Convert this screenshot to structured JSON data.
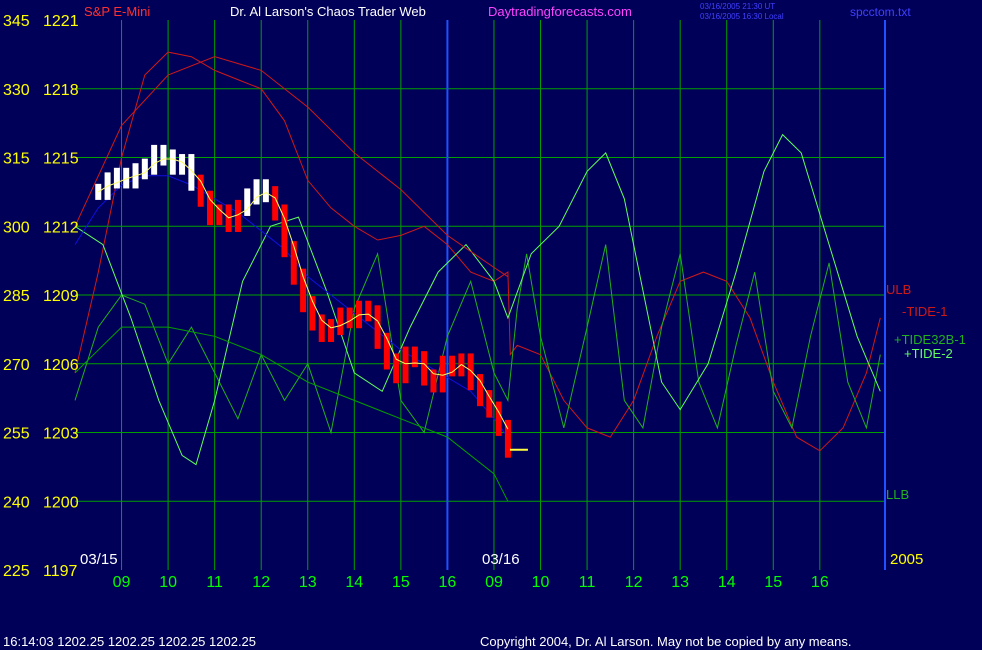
{
  "header": {
    "title_left": "S&P E-Mini",
    "title_main": "Dr. Al Larson's Chaos Trader Web",
    "title_site": "Daytradingforecasts.com",
    "time_ut": "03/16/2005 21:30 UT",
    "time_local": "03/16/2005 16:30 Local",
    "file": "spcctom.txt"
  },
  "footer": {
    "quote": "16:14:03  1202.25  1202.25  1202.25  1202.25",
    "copyright": "Copyright 2004, Dr. Al Larson. May not be copied by any means."
  },
  "colors": {
    "background": "#000058",
    "grid": "#00a000",
    "axis_text": "#ffff00",
    "hour_text": "#00ff00",
    "price_bars": "#ff0000",
    "price_bars_early": "#ffffff",
    "ma": "#ffff60",
    "blue_line": "#1010e0",
    "tide1": "#d01818",
    "tide32b": "#20b020",
    "tide2": "#60ff60",
    "envelope": "#00a000",
    "title_main": "#ffffff",
    "title_site": "#ff44ff",
    "file": "#4040ff"
  },
  "chart_data": {
    "type": "line",
    "y_left_ticks": [
      "345",
      "330",
      "315",
      "300",
      "285",
      "270",
      "255",
      "240",
      "225"
    ],
    "y_right_ticks": [
      "1221",
      "1218",
      "1215",
      "1212",
      "1209",
      "1206",
      "1203",
      "1200",
      "1197"
    ],
    "ylim_price": [
      1197,
      1221
    ],
    "ylim_tide": [
      225,
      345
    ],
    "x_hours": [
      "09",
      "10",
      "11",
      "12",
      "13",
      "14",
      "15",
      "16",
      "09",
      "10",
      "11",
      "12",
      "13",
      "14",
      "15",
      "16"
    ],
    "date_labels": [
      "03/15",
      "03/16"
    ],
    "year_label": "2005",
    "grid": true,
    "labels_right": [
      "ULB",
      "-TIDE-1",
      "+TIDE32B-1",
      "+TIDE-2",
      "LLB"
    ],
    "last_price": 1202.25,
    "price_series": [
      {
        "t": 0.5,
        "v": 1213.5
      },
      {
        "t": 0.7,
        "v": 1214.0
      },
      {
        "t": 0.9,
        "v": 1214.2
      },
      {
        "t": 1.1,
        "v": 1214.0
      },
      {
        "t": 1.3,
        "v": 1214.4
      },
      {
        "t": 1.5,
        "v": 1214.6
      },
      {
        "t": 1.7,
        "v": 1215.2
      },
      {
        "t": 1.9,
        "v": 1215.0
      },
      {
        "t": 2.1,
        "v": 1214.6
      },
      {
        "t": 2.3,
        "v": 1214.8
      },
      {
        "t": 2.5,
        "v": 1213.9
      },
      {
        "t": 2.7,
        "v": 1213.2
      },
      {
        "t": 2.9,
        "v": 1212.4
      },
      {
        "t": 3.1,
        "v": 1212.6
      },
      {
        "t": 3.3,
        "v": 1212.1
      },
      {
        "t": 3.5,
        "v": 1212.8
      },
      {
        "t": 3.7,
        "v": 1213.3
      },
      {
        "t": 3.9,
        "v": 1213.7
      },
      {
        "t": 4.1,
        "v": 1213.4
      },
      {
        "t": 4.3,
        "v": 1212.6
      },
      {
        "t": 4.5,
        "v": 1211.0
      },
      {
        "t": 4.7,
        "v": 1209.8
      },
      {
        "t": 4.9,
        "v": 1208.6
      },
      {
        "t": 5.1,
        "v": 1207.8
      },
      {
        "t": 5.3,
        "v": 1207.3
      },
      {
        "t": 5.5,
        "v": 1207.6
      },
      {
        "t": 5.7,
        "v": 1208.1
      },
      {
        "t": 5.9,
        "v": 1207.9
      },
      {
        "t": 6.1,
        "v": 1208.4
      },
      {
        "t": 6.3,
        "v": 1208.2
      },
      {
        "t": 6.5,
        "v": 1207.0
      },
      {
        "t": 6.7,
        "v": 1206.1
      },
      {
        "t": 6.9,
        "v": 1205.5
      },
      {
        "t": 7.1,
        "v": 1206.4
      },
      {
        "t": 7.3,
        "v": 1206.2
      },
      {
        "t": 7.5,
        "v": 1205.4
      },
      {
        "t": 7.7,
        "v": 1205.1
      },
      {
        "t": 7.9,
        "v": 1206.0
      },
      {
        "t": 8.1,
        "v": 1205.8
      },
      {
        "t": 8.3,
        "v": 1206.1
      },
      {
        "t": 8.5,
        "v": 1205.2
      },
      {
        "t": 8.7,
        "v": 1204.5
      },
      {
        "t": 8.9,
        "v": 1204.0
      },
      {
        "t": 9.1,
        "v": 1203.2
      },
      {
        "t": 9.3,
        "v": 1202.25
      }
    ],
    "series": [
      {
        "name": "-TIDE-1",
        "values": [
          {
            "t": 0,
            "v": 268
          },
          {
            "t": 0.5,
            "v": 290
          },
          {
            "t": 1.0,
            "v": 315
          },
          {
            "t": 1.5,
            "v": 333
          },
          {
            "t": 2.0,
            "v": 338
          },
          {
            "t": 2.5,
            "v": 337
          },
          {
            "t": 3.0,
            "v": 334
          },
          {
            "t": 3.5,
            "v": 332
          },
          {
            "t": 4.0,
            "v": 330
          },
          {
            "t": 4.5,
            "v": 323
          },
          {
            "t": 5.0,
            "v": 310
          },
          {
            "t": 5.5,
            "v": 304
          },
          {
            "t": 6.0,
            "v": 300
          },
          {
            "t": 6.5,
            "v": 297
          },
          {
            "t": 7.0,
            "v": 298
          },
          {
            "t": 7.5,
            "v": 300
          },
          {
            "t": 8.0,
            "v": 296
          },
          {
            "t": 8.5,
            "v": 290
          },
          {
            "t": 9.0,
            "v": 288
          },
          {
            "t": 9.3,
            "v": 290
          },
          {
            "t": 9.35,
            "v": 272
          },
          {
            "t": 9.5,
            "v": 274
          },
          {
            "t": 10.0,
            "v": 272
          },
          {
            "t": 10.5,
            "v": 262
          },
          {
            "t": 11.0,
            "v": 256
          },
          {
            "t": 11.5,
            "v": 254
          },
          {
            "t": 12.0,
            "v": 262
          },
          {
            "t": 12.5,
            "v": 276
          },
          {
            "t": 13.0,
            "v": 288
          },
          {
            "t": 13.5,
            "v": 290
          },
          {
            "t": 14.0,
            "v": 288
          },
          {
            "t": 14.5,
            "v": 280
          },
          {
            "t": 15.0,
            "v": 266
          },
          {
            "t": 15.5,
            "v": 254
          },
          {
            "t": 16.0,
            "v": 251
          },
          {
            "t": 16.5,
            "v": 256
          },
          {
            "t": 17.0,
            "v": 268
          },
          {
            "t": 17.3,
            "v": 280
          }
        ]
      },
      {
        "name": "+TIDE32B-1",
        "values": [
          {
            "t": 0,
            "v": 262
          },
          {
            "t": 0.5,
            "v": 278
          },
          {
            "t": 1.0,
            "v": 285
          },
          {
            "t": 1.5,
            "v": 283
          },
          {
            "t": 2.0,
            "v": 270
          },
          {
            "t": 2.5,
            "v": 278
          },
          {
            "t": 3.0,
            "v": 268
          },
          {
            "t": 3.5,
            "v": 258
          },
          {
            "t": 4.0,
            "v": 272
          },
          {
            "t": 4.5,
            "v": 262
          },
          {
            "t": 5.0,
            "v": 270
          },
          {
            "t": 5.5,
            "v": 255
          },
          {
            "t": 6.0,
            "v": 282
          },
          {
            "t": 6.5,
            "v": 294
          },
          {
            "t": 7.0,
            "v": 262
          },
          {
            "t": 7.5,
            "v": 255
          },
          {
            "t": 8.0,
            "v": 276
          },
          {
            "t": 8.5,
            "v": 288
          },
          {
            "t": 9.0,
            "v": 268
          },
          {
            "t": 9.3,
            "v": 262
          },
          {
            "t": 9.5,
            "v": 282
          },
          {
            "t": 9.7,
            "v": 294
          },
          {
            "t": 10.0,
            "v": 276
          },
          {
            "t": 10.5,
            "v": 256
          },
          {
            "t": 11.0,
            "v": 278
          },
          {
            "t": 11.4,
            "v": 296
          },
          {
            "t": 11.8,
            "v": 262
          },
          {
            "t": 12.2,
            "v": 256
          },
          {
            "t": 12.6,
            "v": 278
          },
          {
            "t": 13.0,
            "v": 294
          },
          {
            "t": 13.4,
            "v": 266
          },
          {
            "t": 13.8,
            "v": 256
          },
          {
            "t": 14.2,
            "v": 274
          },
          {
            "t": 14.6,
            "v": 290
          },
          {
            "t": 15.0,
            "v": 264
          },
          {
            "t": 15.4,
            "v": 256
          },
          {
            "t": 15.8,
            "v": 276
          },
          {
            "t": 16.2,
            "v": 292
          },
          {
            "t": 16.6,
            "v": 266
          },
          {
            "t": 17.0,
            "v": 256
          },
          {
            "t": 17.3,
            "v": 272
          }
        ]
      },
      {
        "name": "+TIDE-2",
        "values": [
          {
            "t": 0,
            "v": 300
          },
          {
            "t": 0.6,
            "v": 296
          },
          {
            "t": 1.2,
            "v": 280
          },
          {
            "t": 1.8,
            "v": 262
          },
          {
            "t": 2.3,
            "v": 250
          },
          {
            "t": 2.6,
            "v": 248
          },
          {
            "t": 3.0,
            "v": 262
          },
          {
            "t": 3.6,
            "v": 288
          },
          {
            "t": 4.2,
            "v": 300
          },
          {
            "t": 4.8,
            "v": 302
          },
          {
            "t": 5.4,
            "v": 286
          },
          {
            "t": 6.0,
            "v": 268
          },
          {
            "t": 6.6,
            "v": 264
          },
          {
            "t": 7.2,
            "v": 278
          },
          {
            "t": 7.8,
            "v": 290
          },
          {
            "t": 8.4,
            "v": 296
          },
          {
            "t": 9.0,
            "v": 288
          },
          {
            "t": 9.3,
            "v": 280
          },
          {
            "t": 9.8,
            "v": 294
          },
          {
            "t": 10.4,
            "v": 300
          },
          {
            "t": 11.0,
            "v": 312
          },
          {
            "t": 11.4,
            "v": 316
          },
          {
            "t": 11.8,
            "v": 306
          },
          {
            "t": 12.2,
            "v": 286
          },
          {
            "t": 12.6,
            "v": 266
          },
          {
            "t": 13.0,
            "v": 260
          },
          {
            "t": 13.6,
            "v": 270
          },
          {
            "t": 14.2,
            "v": 290
          },
          {
            "t": 14.8,
            "v": 312
          },
          {
            "t": 15.2,
            "v": 320
          },
          {
            "t": 15.6,
            "v": 316
          },
          {
            "t": 16.2,
            "v": 296
          },
          {
            "t": 16.8,
            "v": 276
          },
          {
            "t": 17.3,
            "v": 264
          }
        ]
      },
      {
        "name": "ULB",
        "values": [
          {
            "t": 0,
            "v": 300
          },
          {
            "t": 1.0,
            "v": 322
          },
          {
            "t": 2.0,
            "v": 333
          },
          {
            "t": 3.0,
            "v": 337
          },
          {
            "t": 4.0,
            "v": 334
          },
          {
            "t": 5.0,
            "v": 326
          },
          {
            "t": 6.0,
            "v": 316
          },
          {
            "t": 7.0,
            "v": 308
          },
          {
            "t": 8.0,
            "v": 298
          },
          {
            "t": 9.0,
            "v": 291
          },
          {
            "t": 9.3,
            "v": 289
          }
        ]
      },
      {
        "name": "LLB",
        "values": [
          {
            "t": 0,
            "v": 268
          },
          {
            "t": 1.0,
            "v": 278
          },
          {
            "t": 2.0,
            "v": 278
          },
          {
            "t": 3.0,
            "v": 276
          },
          {
            "t": 4.0,
            "v": 272
          },
          {
            "t": 5.0,
            "v": 266
          },
          {
            "t": 6.0,
            "v": 262
          },
          {
            "t": 7.0,
            "v": 258
          },
          {
            "t": 8.0,
            "v": 254
          },
          {
            "t": 9.0,
            "v": 246
          },
          {
            "t": 9.3,
            "v": 240
          }
        ]
      },
      {
        "name": "",
        "values": [
          {
            "t": 0,
            "v": 296
          },
          {
            "t": 0.5,
            "v": 304
          },
          {
            "t": 1.0,
            "v": 309
          },
          {
            "t": 1.5,
            "v": 311
          },
          {
            "t": 2.0,
            "v": 311
          },
          {
            "t": 2.5,
            "v": 309
          },
          {
            "t": 3.0,
            "v": 306
          },
          {
            "t": 3.5,
            "v": 303
          },
          {
            "t": 4.0,
            "v": 299
          },
          {
            "t": 4.5,
            "v": 295
          },
          {
            "t": 5.0,
            "v": 289
          },
          {
            "t": 5.5,
            "v": 285
          },
          {
            "t": 6.0,
            "v": 281
          },
          {
            "t": 6.5,
            "v": 277
          },
          {
            "t": 7.0,
            "v": 273
          },
          {
            "t": 7.5,
            "v": 270
          },
          {
            "t": 8.0,
            "v": 267
          },
          {
            "t": 8.5,
            "v": 264
          },
          {
            "t": 9.0,
            "v": 258
          },
          {
            "t": 9.3,
            "v": 254
          }
        ]
      }
    ]
  }
}
